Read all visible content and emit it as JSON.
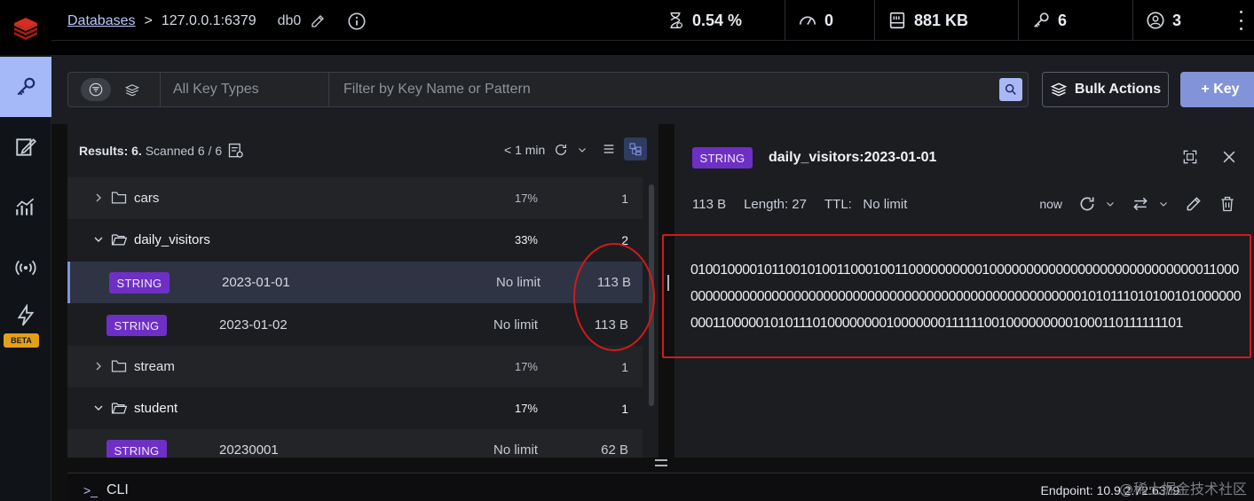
{
  "header": {
    "databases_link": "Databases",
    "separator": ">",
    "host": "127.0.0.1:6379",
    "db": "db0",
    "stats": [
      {
        "icon": "cpu-icon",
        "value": "0.54 %"
      },
      {
        "icon": "gauge-icon",
        "value": "0"
      },
      {
        "icon": "memory-icon",
        "value": "881 KB"
      },
      {
        "icon": "key-icon",
        "value": "6"
      },
      {
        "icon": "user-icon",
        "value": "3"
      }
    ]
  },
  "nav": {
    "items": [
      "browser-icon",
      "workbench-icon",
      "analytics-icon",
      "pubsub-icon",
      "triggers-icon"
    ],
    "beta_label": "BETA"
  },
  "filter": {
    "key_types": "All Key Types",
    "search_placeholder": "Filter by Key Name or Pattern",
    "bulk_actions": "Bulk Actions",
    "add_key": "+ Key"
  },
  "list": {
    "results_label": "Results: 6.",
    "scanned": "Scanned 6 / 6",
    "refreshed": "< 1 min",
    "rows": [
      {
        "type": "folder",
        "name": "cars",
        "pct": "17%",
        "count": "1",
        "open": false
      },
      {
        "type": "folder",
        "name": "daily_visitors",
        "pct": "33%",
        "count": "2",
        "open": true
      },
      {
        "type": "key",
        "badge": "STRING",
        "name": "2023-01-01",
        "ttl": "No limit",
        "size": "113 B",
        "selected": true
      },
      {
        "type": "key",
        "badge": "STRING",
        "name": "2023-01-02",
        "ttl": "No limit",
        "size": "113 B"
      },
      {
        "type": "folder",
        "name": "stream",
        "pct": "17%",
        "count": "1",
        "open": false
      },
      {
        "type": "folder",
        "name": "student",
        "pct": "17%",
        "count": "1",
        "open": true
      },
      {
        "type": "key",
        "badge": "STRING",
        "name": "20230001",
        "ttl": "No limit",
        "size": "62 B"
      }
    ]
  },
  "details": {
    "badge": "STRING",
    "key": "daily_visitors:2023-01-01",
    "size": "113 B",
    "length": "Length: 27",
    "ttl_label": "TTL:",
    "ttl_value": "No limit",
    "refreshed": "now",
    "value": "010010000101100101001100010011000000000010000000000000000000000000000011000000000000000000000000000000000000000000000000000000001010111010100101000000000110000010101110100000000100000001111110010000000001000110111111101"
  },
  "cli": {
    "label": "CLI",
    "endpoint": "Endpoint: 10.9.2.72:6379"
  },
  "watermark": "@稀土掘金技术社区",
  "colors": {
    "accent": "#a5b8f8",
    "string_badge": "#6e30c4",
    "annotation_red": "#d11a1a"
  }
}
